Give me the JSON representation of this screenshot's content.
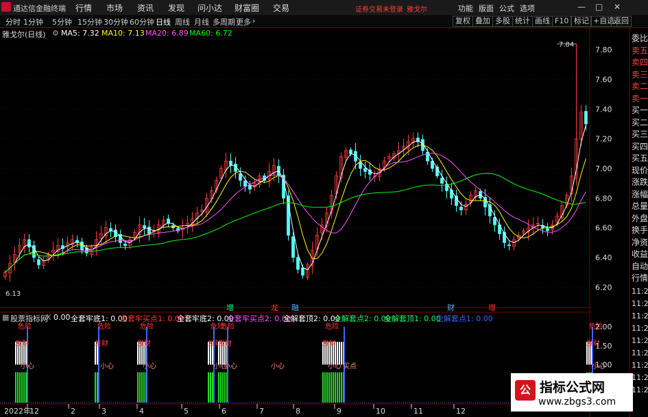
{
  "titlebar": {
    "app_title": "通达信金融终端",
    "menus": [
      "行情",
      "市场",
      "资讯",
      "发现",
      "问小达",
      "财富圈",
      "交易"
    ],
    "red_links": [
      "证券交易未登录",
      "雅戈尔"
    ],
    "right_menus": [
      "功能",
      "版面",
      "公式",
      "选项"
    ],
    "window_buttons": [
      "—",
      "□",
      "✕"
    ]
  },
  "toolbar": {
    "periods": [
      "分时",
      "1分钟",
      "5分钟",
      "15分钟",
      "30分钟",
      "60分钟",
      "日线",
      "周线",
      "月线",
      "多周期",
      "更多"
    ],
    "active_period": "日线",
    "buttons": [
      "复权",
      "叠加",
      "多股",
      "统计",
      "画线",
      "F10",
      "标记",
      "+自选",
      "返回"
    ]
  },
  "infobar": {
    "stock": "雅戈尔(日线)",
    "ma5": "MA5: 7.32",
    "ma10": "MA10: 7.13",
    "ma20": "MA20: 6.89",
    "ma60": "MA60: 6.72",
    "colors": {
      "ma5": "#ffffff",
      "ma10": "#ffff00",
      "ma20": "#ff55ff",
      "ma60": "#00ff00"
    }
  },
  "price_axis": {
    "ticks": [
      "7.80",
      "7.60",
      "7.40",
      "7.20",
      "7.00",
      "6.80",
      "6.60",
      "6.40",
      "6.20"
    ]
  },
  "annotations": {
    "high": "7.84",
    "low": "6.13"
  },
  "markers": [
    {
      "text": "增",
      "color": "#00ff88"
    },
    {
      "text": "龙",
      "color": "#ff3333"
    },
    {
      "text": "融",
      "color": "#55aaff"
    },
    {
      "text": "财",
      "color": "#55aaff"
    },
    {
      "text": "增",
      "color": "#ff3333"
    }
  ],
  "indicator": {
    "name": "股票指标网",
    "close": "X",
    "values": [
      {
        "text": "0.00",
        "color": "#ffffff"
      },
      {
        "text": "全套牢底1: 0.00",
        "color": "#ffffff"
      },
      {
        "text": "全套牢买点1: 0.00",
        "color": "#ff3c3c"
      },
      {
        "text": "全套牢底2: 0.00",
        "color": "#ffffff"
      },
      {
        "text": "全套牢买点2: 0.00",
        "color": "#ff55ff"
      },
      {
        "text": "全解套顶2: 0.00",
        "color": "#ffffff"
      },
      {
        "text": "全解套点2: 0.00",
        "color": "#00ff66"
      },
      {
        "text": "全解套顶1: 0.00",
        "color": "#00ff66"
      },
      {
        "text": "全解套点1: 0.00",
        "color": "#3366ff"
      }
    ],
    "axis_ticks": [
      "2.00",
      "1.50",
      "1.00"
    ],
    "labels": {
      "danger": "危险",
      "fortune": "发财",
      "careful": "小心",
      "bought": "买点"
    }
  },
  "date_axis": {
    "year": "2022年",
    "months": [
      "12",
      "2",
      "3",
      "4",
      "5",
      "6",
      "7",
      "8",
      "9",
      "10",
      "11",
      "12"
    ]
  },
  "side_panel": {
    "items": [
      "委比",
      "卖五",
      "卖四",
      "卖三",
      "卖二",
      "卖一",
      "买一",
      "买二",
      "买三",
      "买四",
      "买五",
      "现价",
      "涨跌",
      "涨幅",
      "总量",
      "外盘",
      "换手",
      "净资",
      "收益",
      "自动",
      "行情"
    ],
    "times": [
      "11:29",
      "11:29",
      "11:29",
      "11:29",
      "11:29",
      "11:29",
      "11:29",
      "11:29",
      "11:29"
    ]
  },
  "watermark": {
    "title": "指标公式网",
    "url": "www.zbgs3.com",
    "icon": "公"
  },
  "chart_data": {
    "type": "candlestick",
    "title": "雅戈尔(日线)",
    "ylim": [
      6.1,
      7.9
    ],
    "ma_current": {
      "MA5": 7.32,
      "MA10": 7.13,
      "MA20": 6.89,
      "MA60": 6.72
    },
    "high_label": 7.84,
    "low_label": 6.13,
    "close_path": [
      6.3,
      6.36,
      6.42,
      6.48,
      6.52,
      6.47,
      6.4,
      6.35,
      6.38,
      6.42,
      6.45,
      6.48,
      6.46,
      6.5,
      6.52,
      6.5,
      6.45,
      6.43,
      6.47,
      6.52,
      6.56,
      6.6,
      6.58,
      6.54,
      6.5,
      6.48,
      6.52,
      6.57,
      6.62,
      6.6,
      6.56,
      6.58,
      6.62,
      6.65,
      6.63,
      6.6,
      6.58,
      6.6,
      6.63,
      6.66,
      6.7,
      6.72,
      6.8,
      6.85,
      6.92,
      7.0,
      7.05,
      7.02,
      6.98,
      6.92,
      6.88,
      6.86,
      6.9,
      6.95,
      6.92,
      6.98,
      7.02,
      6.95,
      6.8,
      6.55,
      6.4,
      6.32,
      6.28,
      6.35,
      6.45,
      6.55,
      6.62,
      6.7,
      6.82,
      6.95,
      7.08,
      7.12,
      7.1,
      7.05,
      7.0,
      6.98,
      6.96,
      6.95,
      7.0,
      7.05,
      7.08,
      7.1,
      7.12,
      7.15,
      7.18,
      7.2,
      7.18,
      7.12,
      7.05,
      7.0,
      6.95,
      6.9,
      6.85,
      6.8,
      6.75,
      6.72,
      6.76,
      6.82,
      6.85,
      6.8,
      6.74,
      6.68,
      6.62,
      6.56,
      6.5,
      6.48,
      6.52,
      6.55,
      6.58,
      6.6,
      6.62,
      6.63,
      6.6,
      6.58,
      6.62,
      6.68,
      6.75,
      6.82,
      6.95,
      7.2,
      7.38,
      7.3
    ]
  }
}
